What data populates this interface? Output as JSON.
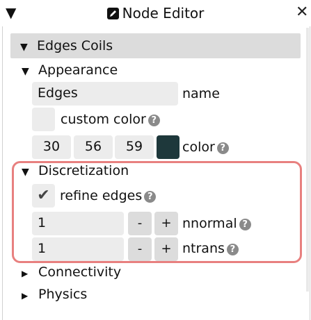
{
  "window": {
    "collapse_glyph": "▼",
    "title": "Node Editor",
    "close_glyph": "✕"
  },
  "section": {
    "glyph": "▼",
    "label": "Edges Coils"
  },
  "appearance": {
    "glyph": "▼",
    "label": "Appearance",
    "name_value": "Edges",
    "name_label": "name",
    "custom_color_label": "custom color",
    "color_r": "30",
    "color_g": "56",
    "color_b": "59",
    "swatch_color": "#1e383b",
    "color_label": "color"
  },
  "discretization": {
    "glyph": "▼",
    "label": "Discretization",
    "refine_checked": true,
    "refine_label": "refine edges",
    "nnormal_value": "1",
    "nnormal_label": "nnormal",
    "ntrans_value": "1",
    "ntrans_label": "ntrans",
    "minus": "-",
    "plus": "+"
  },
  "collapsed": [
    {
      "glyph": "▶",
      "label": "Connectivity"
    },
    {
      "glyph": "▶",
      "label": "Physics"
    }
  ],
  "icons": {
    "help": "?",
    "check": "✔"
  },
  "highlight_color": "#e8807f"
}
